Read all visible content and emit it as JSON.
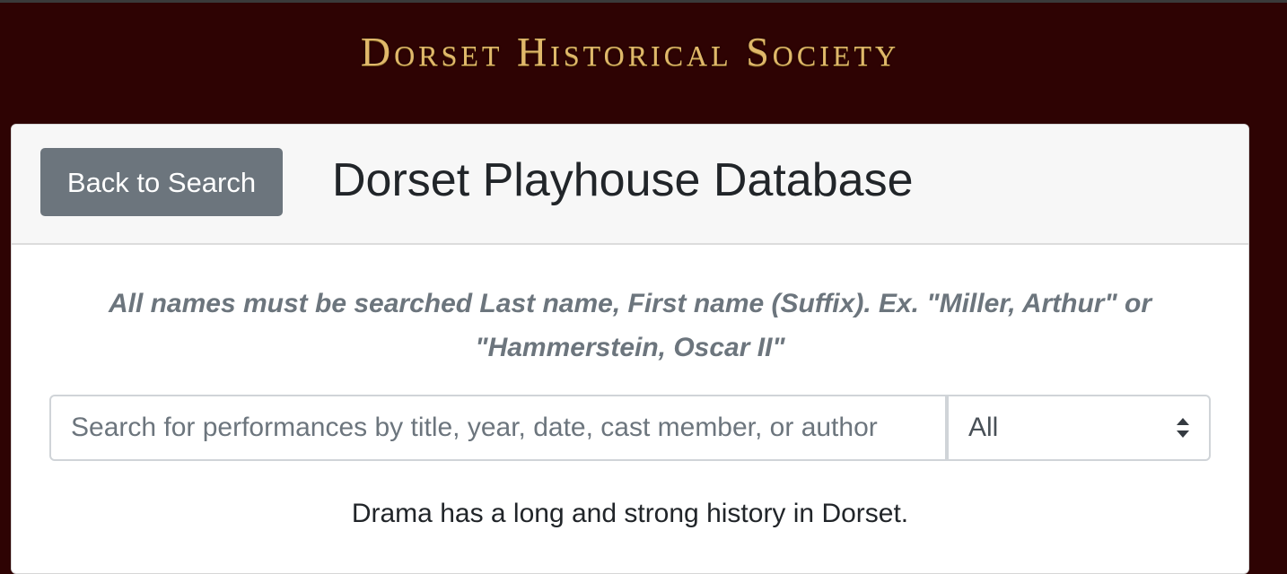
{
  "site": {
    "title": "Dorset Historical Society"
  },
  "header": {
    "back_label": "Back to Search",
    "title": "Dorset Playhouse Database"
  },
  "main": {
    "instructions": "All names must be searched Last name, First name (Suffix). Ex. \"Miller, Arthur\" or \"Hammerstein, Oscar II\"",
    "search": {
      "placeholder": "Search for performances by title, year, date, cast member, or author",
      "value": ""
    },
    "filter": {
      "selected": "All"
    },
    "intro": "Drama has a long and strong history in Dorset."
  },
  "colors": {
    "background": "#2e0303",
    "title_gold": "#e0b86a",
    "button_gray": "#6c757d",
    "instruction_gray": "#6c757d"
  },
  "icons": {
    "select_arrows": "sort-arrows-icon"
  }
}
